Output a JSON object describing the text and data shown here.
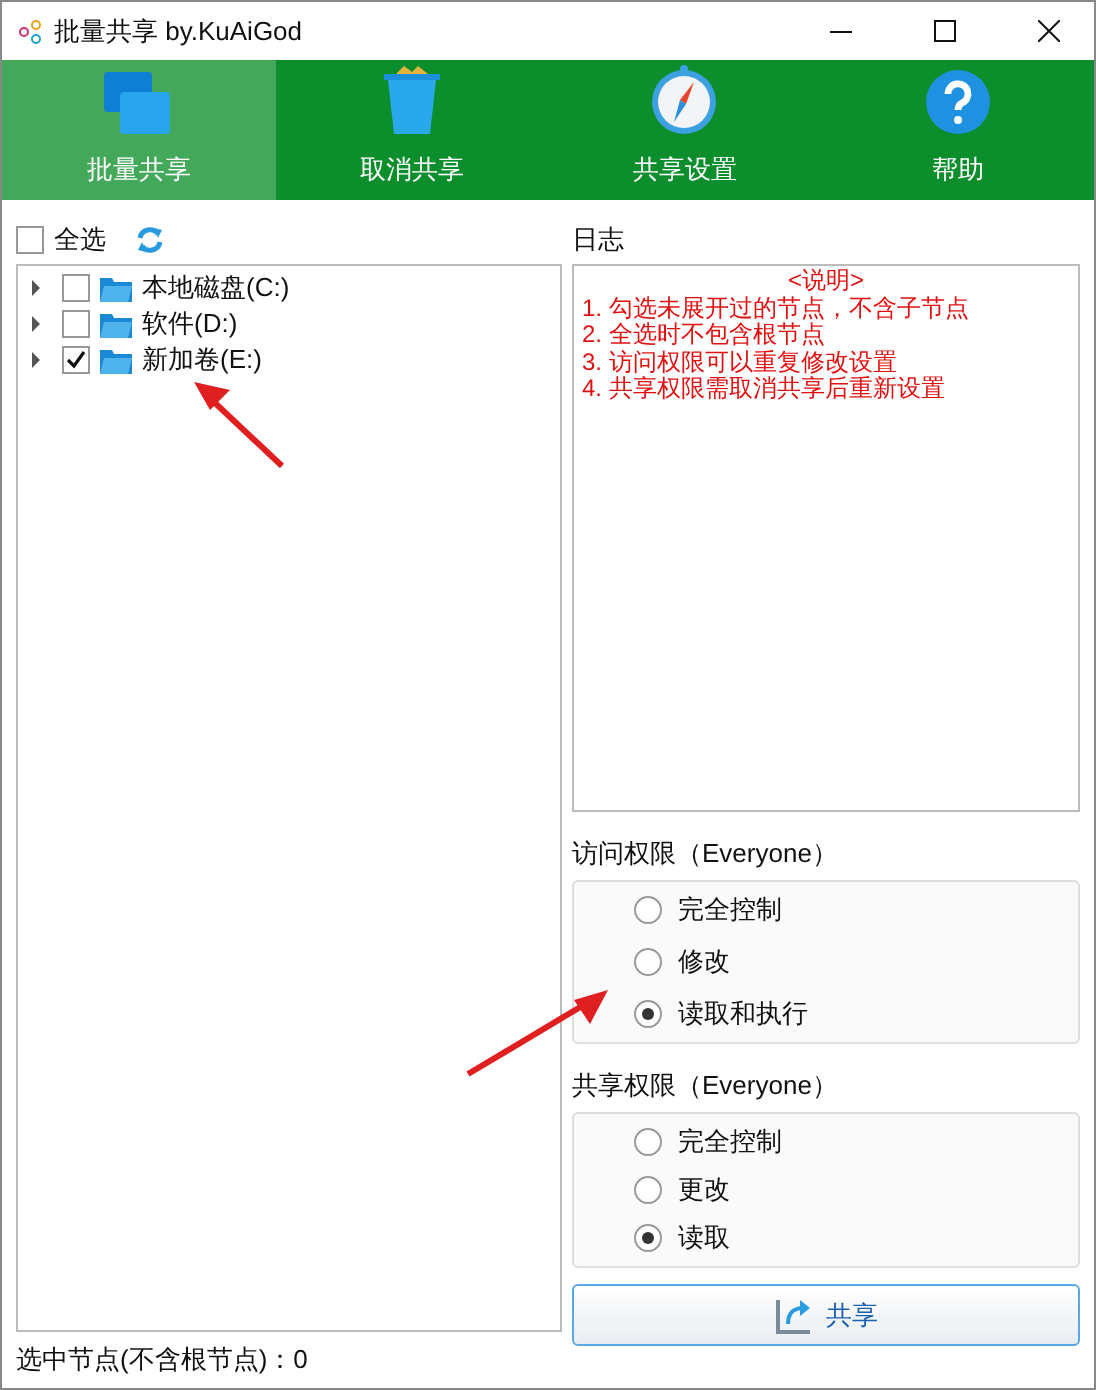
{
  "window": {
    "title": "批量共享 by.KuAiGod"
  },
  "toolbar": [
    {
      "label": "批量共享",
      "selected": true,
      "kind": "windows"
    },
    {
      "label": "取消共享",
      "selected": false,
      "kind": "bin"
    },
    {
      "label": "共享设置",
      "selected": false,
      "kind": "compass"
    },
    {
      "label": "帮助",
      "selected": false,
      "kind": "help"
    }
  ],
  "tree_panel": {
    "select_all": {
      "label": "全选",
      "checked": false
    },
    "nodes": [
      {
        "label": "本地磁盘(C:)",
        "checked": false,
        "expanded": false
      },
      {
        "label": "软件(D:)",
        "checked": false,
        "expanded": false
      },
      {
        "label": "新加卷(E:)",
        "checked": true,
        "expanded": false
      }
    ]
  },
  "log": {
    "title": "日志",
    "heading": "<说明>",
    "lines": [
      "1. 勾选未展开过的节点，不含子节点",
      "2. 全选时不包含根节点",
      "3. 访问权限可以重复修改设置",
      "4. 共享权限需取消共享后重新设置"
    ]
  },
  "access_permissions": {
    "title": "访问权限（Everyone）",
    "options": [
      {
        "label": "完全控制",
        "selected": false
      },
      {
        "label": "修改",
        "selected": false
      },
      {
        "label": "读取和执行",
        "selected": true
      }
    ]
  },
  "share_permissions": {
    "title": "共享权限（Everyone）",
    "options": [
      {
        "label": "完全控制",
        "selected": false
      },
      {
        "label": "更改",
        "selected": false
      },
      {
        "label": "读取",
        "selected": true
      }
    ]
  },
  "share_button": {
    "label": "共享"
  },
  "status_bar": {
    "text": "选中节点(不含根节点)：0"
  }
}
